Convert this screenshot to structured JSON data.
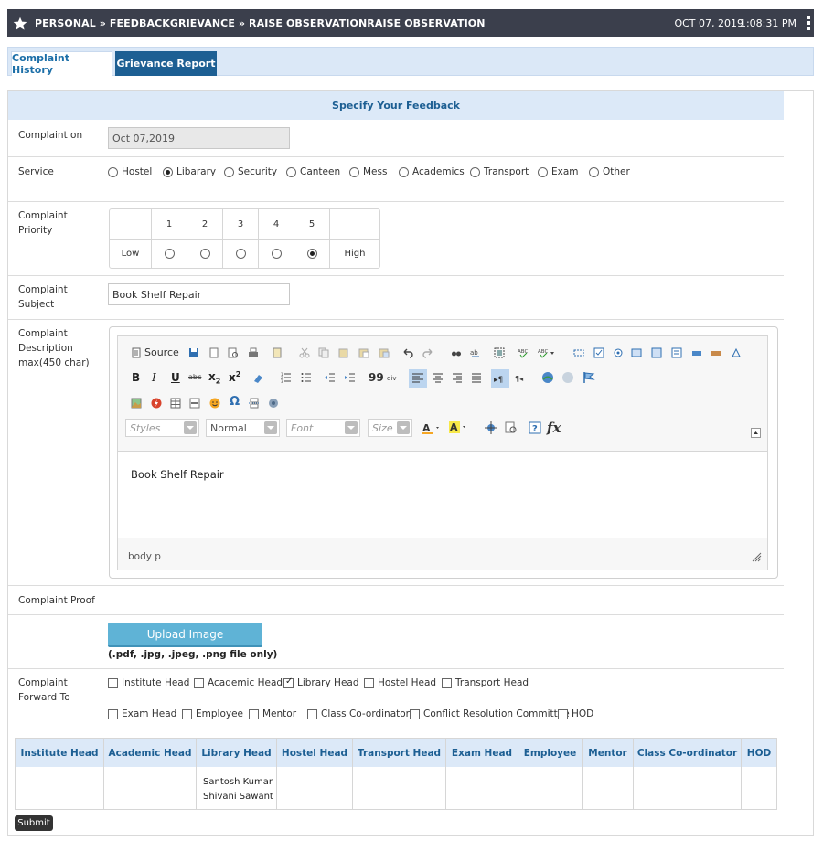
{
  "header": {
    "breadcrumb": "PERSONAL » FEEDBACKGRIEVANCE » RAISE OBSERVATIONRAISE OBSERVATION",
    "date": "OCT 07, 2019",
    "time": "1:08:31 PM"
  },
  "tabs": [
    {
      "label": "Complaint History",
      "active": false
    },
    {
      "label": "Grievance Report",
      "active": true
    }
  ],
  "form": {
    "title": "Specify Your Feedback",
    "complaint_on_label": "Complaint on",
    "complaint_on_value": "Oct 07,2019",
    "service_label": "Service",
    "services": [
      "Hostel",
      "Libarary",
      "Security",
      "Canteen",
      "Mess",
      "Academics",
      "Transport",
      "Exam",
      "Other"
    ],
    "service_selected": "Libarary",
    "priority_label_1": "Complaint",
    "priority_label_2": "Priority",
    "priority_levels": [
      "1",
      "2",
      "3",
      "4",
      "5"
    ],
    "priority_low": "Low",
    "priority_high": "High",
    "priority_selected": "5",
    "subject_label_1": "Complaint",
    "subject_label_2": "Subject",
    "subject_value": "Book Shelf Repair",
    "description_label_1": "Complaint",
    "description_label_2": "Description",
    "description_label_3": "max(450 char)",
    "editor": {
      "source_label": "Source",
      "styles_placeholder": "Styles",
      "format_value": "Normal",
      "font_placeholder": "Font",
      "size_placeholder": "Size",
      "content": "Book Shelf Repair",
      "path": "body  p"
    },
    "proof_label": "Complaint Proof",
    "upload_button": "Upload Image",
    "upload_note": "(.pdf, .jpg, .jpeg, .png file only)",
    "forward_label_1": "Complaint",
    "forward_label_2": "Forward To",
    "forward_options": [
      "Institute Head",
      "Academic Head",
      "Library Head",
      "Hostel Head",
      "Transport Head",
      "Exam Head",
      "Employee",
      "Mentor",
      "Class Co-ordinator",
      "Conflict Resolution Committee",
      "HOD"
    ],
    "forward_checked": [
      "Library Head"
    ],
    "heads_table": {
      "columns": [
        "Institute Head",
        "Academic Head",
        "Library Head",
        "Hostel Head",
        "Transport Head",
        "Exam Head",
        "Employee",
        "Mentor",
        "Class Co-ordinator",
        "HOD"
      ],
      "library_head_names": [
        "Santosh Kumar",
        "Shivani Sawant"
      ]
    },
    "submit_label": "Submit"
  }
}
